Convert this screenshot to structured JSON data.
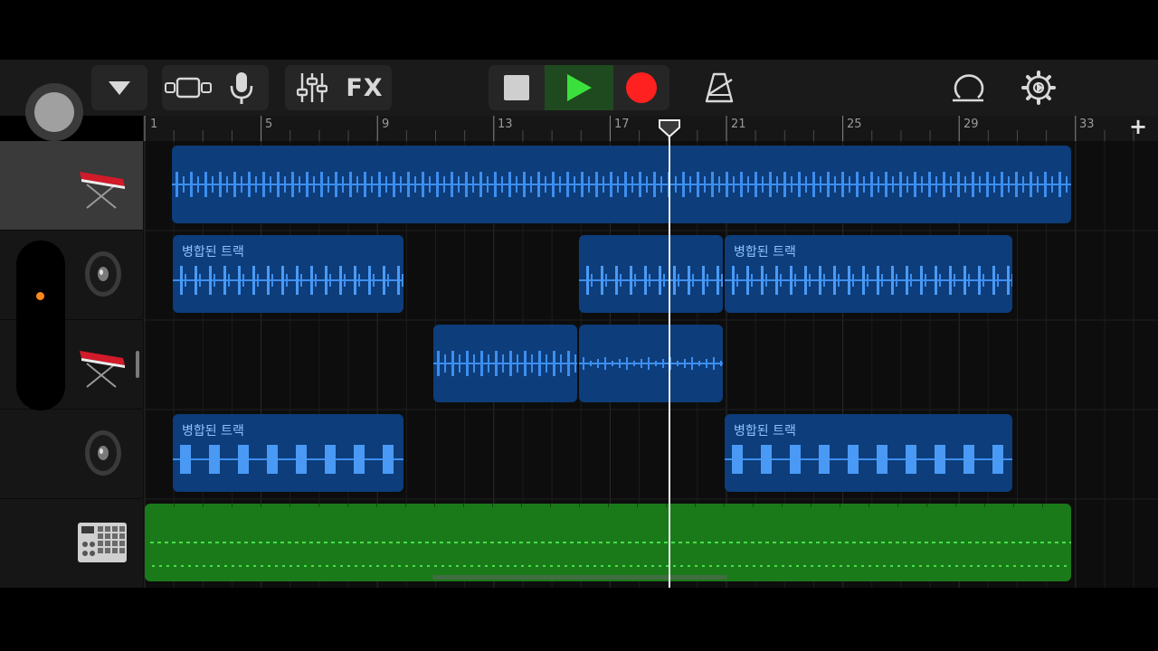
{
  "toolbar": {
    "fx_label": "FX"
  },
  "ruler": {
    "bar_numbers": [
      "1",
      "5",
      "9",
      "13",
      "17",
      "21",
      "25",
      "29",
      "33"
    ],
    "add_label": "+"
  },
  "tracks": [
    {
      "instrument": "keyboard-icon",
      "selected": true
    },
    {
      "instrument": "speaker-icon",
      "selected": false
    },
    {
      "instrument": "keyboard-icon",
      "selected": false
    },
    {
      "instrument": "speaker-icon",
      "selected": false
    },
    {
      "instrument": "drum-machine-icon",
      "selected": false
    }
  ],
  "regions": {
    "track2_a": "병합된 트랙",
    "track2_c": "병합된 트랙",
    "track4_a": "병합된 트랙",
    "track4_b": "병합된 트랙"
  },
  "colors": {
    "region_blue": "#0d3d7a",
    "wave_blue": "#3d8ef0",
    "region_green": "#1a7a1a",
    "play_green": "#3ce03c",
    "record_red": "#ff2020"
  }
}
